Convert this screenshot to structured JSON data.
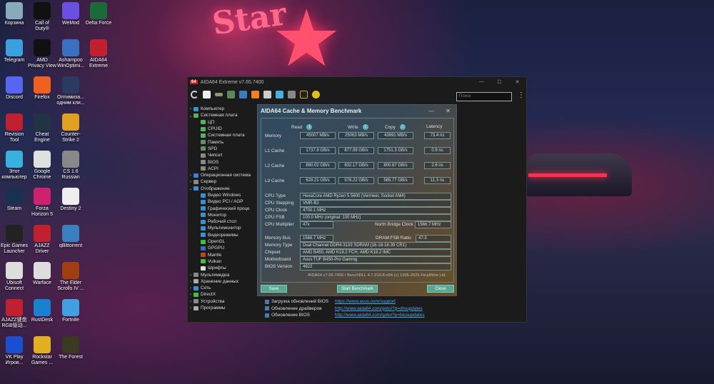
{
  "desktop": {
    "icons": [
      [
        "Корзина",
        "Telegram",
        "Discord",
        "Revision Tool",
        "Этот компьютер",
        "Steam",
        "Epic Games Launcher",
        "Ubisoft Connect",
        "AJAZZ键盘RGB驱动...",
        "VK Play Игров..."
      ],
      [
        "Call of Duty®",
        "AMD Privacy View",
        "Firefox",
        "Cheat Engine",
        "Google Chrome",
        "Forza Horizon 5",
        "AJAZZ Driver",
        "Warface",
        "RustDesk",
        "Rockstar Games ..."
      ],
      [
        "WeMod",
        "Ashampoo WinOptimi...",
        "Оптимиза... одним кли...",
        "Counter-Strike 2",
        "CS 1.6 Russian",
        "Destiny 2",
        "qBittorrent",
        "The Elder Scrolls IV ...",
        "Fortnite",
        "The Forest"
      ],
      [
        "Delta Force",
        "AIDA64 Extreme"
      ]
    ]
  },
  "wallpaper": {
    "sign": "Star"
  },
  "aida": {
    "title": "AIDA64 Extreme v7.65.7400",
    "logo": "64",
    "search_placeholder": "Поиск",
    "tree": [
      {
        "label": "Компьютер",
        "lvl": 0,
        "exp": ">"
      },
      {
        "label": "Системная плата",
        "lvl": 0,
        "exp": "v"
      },
      {
        "label": "ЦП",
        "lvl": 1
      },
      {
        "label": "CPUID",
        "lvl": 1
      },
      {
        "label": "Системная плата",
        "lvl": 1
      },
      {
        "label": "Память",
        "lvl": 1
      },
      {
        "label": "SPD",
        "lvl": 1
      },
      {
        "label": "Чипсет",
        "lvl": 1
      },
      {
        "label": "BIOS",
        "lvl": 1
      },
      {
        "label": "ACPI",
        "lvl": 1
      },
      {
        "label": "Операционная система",
        "lvl": 0,
        "exp": ">"
      },
      {
        "label": "Сервер",
        "lvl": 0,
        "exp": ">"
      },
      {
        "label": "Отображение",
        "lvl": 0,
        "exp": "v"
      },
      {
        "label": "Видео Windows",
        "lvl": 1
      },
      {
        "label": "Видео PCI / AGP",
        "lvl": 1
      },
      {
        "label": "Графический проце",
        "lvl": 1
      },
      {
        "label": "Монитор",
        "lvl": 1
      },
      {
        "label": "Рабочий стол",
        "lvl": 1
      },
      {
        "label": "Мультимонитор",
        "lvl": 1
      },
      {
        "label": "Видеорежимы",
        "lvl": 1
      },
      {
        "label": "OpenGL",
        "lvl": 1
      },
      {
        "label": "GPGPU",
        "lvl": 1
      },
      {
        "label": "Mantle",
        "lvl": 1
      },
      {
        "label": "Vulkan",
        "lvl": 1
      },
      {
        "label": "Шрифты",
        "lvl": 1
      },
      {
        "label": "Мультимедиа",
        "lvl": 0,
        "exp": ">"
      },
      {
        "label": "Хранение данных",
        "lvl": 0,
        "exp": ">"
      },
      {
        "label": "Сеть",
        "lvl": 0,
        "exp": ">"
      },
      {
        "label": "DirectX",
        "lvl": 0,
        "exp": ">"
      },
      {
        "label": "Устройства",
        "lvl": 0,
        "exp": ">"
      },
      {
        "label": "Программы",
        "lvl": 0,
        "exp": ">"
      }
    ],
    "links": [
      {
        "label": "Загрузка обновлений BIOS",
        "url": "https://www.asus.com/support"
      },
      {
        "label": "Обновление драйверов",
        "url": "http://www.aida64.com/goto/?p=drvupdates"
      },
      {
        "label": "Обновление BIOS",
        "url": "http://www.aida64.com/goto/?p=biosupdates"
      }
    ]
  },
  "bench": {
    "title": "AIDA64 Cache & Memory Benchmark",
    "headers": [
      "Read",
      "Write",
      "Copy",
      "Latency"
    ],
    "rows": [
      {
        "label": "Memory",
        "v": [
          "45007 MB/s",
          "25063 MB/s",
          "43691 MB/s",
          "73.4 ns"
        ]
      },
      {
        "label": "L1 Cache",
        "v": [
          "1737.9 GB/s",
          "877.99 GB/s",
          "1751.3 GB/s",
          "0.9 ns"
        ]
      },
      {
        "label": "L2 Cache",
        "v": [
          "880.02 GB/s",
          "832.17 GB/s",
          "800.87 GB/s",
          "2.6 ns"
        ]
      },
      {
        "label": "L3 Cache",
        "v": [
          "628.21 GB/s",
          "576.22 GB/s",
          "585.77 GB/s",
          "11.3 ns"
        ]
      }
    ],
    "cpu_type_label": "CPU Type",
    "cpu_type": "HexaCore AMD Ryzen 5 5600  (Vermeer, Socket AM4)",
    "cpu_stepping_label": "CPU Stepping",
    "cpu_stepping": "VMR-B2",
    "cpu_clock_label": "CPU Clock",
    "cpu_clock": "4700.1 MHz",
    "cpu_fsb_label": "CPU FSB",
    "cpu_fsb": "100.0 MHz  (original: 100 MHz)",
    "cpu_mult_label": "CPU Multiplier",
    "cpu_mult": "47x",
    "nb_clock_label": "North Bridge Clock",
    "nb_clock": "1566.7 MHz",
    "mem_bus_label": "Memory Bus",
    "mem_bus": "1566.7 MHz",
    "dram_ratio_label": "DRAM:FSB Ratio",
    "dram_ratio": "47:3",
    "mem_type_label": "Memory Type",
    "mem_type": "Dual Channel DDR4-3133 SDRAM  (16-18-18-39 CR1)",
    "chipset_label": "Chipset",
    "chipset": "AMD B450, AMD K19.2 FCH, AMD K19.2 IMC",
    "mobo_label": "Motherboard",
    "mobo": "Asus TUF B450-Pro Gaming",
    "bios_label": "BIOS Version",
    "bios": "4622",
    "footer": "AIDA64 v7.65.7400 / BenchDLL 4.7.916.8-x64  (c) 1995-2025 FinalWire Ltd.",
    "save": "Save",
    "start": "Start Benchmark",
    "close": "Close"
  }
}
